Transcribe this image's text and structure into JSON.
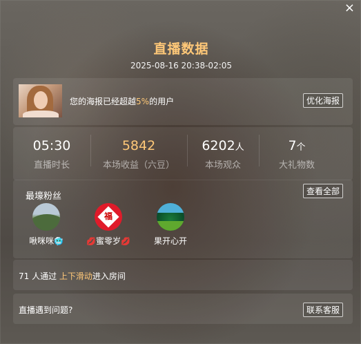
{
  "close_label": "×",
  "title": "直播数据",
  "time_range": "2025-08-16 20:38-02:05",
  "poster": {
    "text_before": "您的海报已经超越",
    "percent": "5%",
    "text_after": "的用户",
    "button": "优化海报"
  },
  "stats": [
    {
      "value": "05:30",
      "unit": "",
      "label": "直播时长"
    },
    {
      "value": "5842",
      "unit": "",
      "label": "本场收益（六豆）"
    },
    {
      "value": "6202",
      "unit": "人",
      "label": "本场观众"
    },
    {
      "value": "7",
      "unit": "个",
      "label": "大礼物数"
    }
  ],
  "fans": {
    "title": "最壕粉丝",
    "view_all": "查看全部",
    "items": [
      {
        "name": "啾咪咪",
        "suffix": "🥶",
        "prefix": ""
      },
      {
        "name": "蜜零岁",
        "suffix": "💋",
        "prefix": "💋"
      },
      {
        "name": "果开心开",
        "suffix": "",
        "prefix": ""
      }
    ],
    "avatar_glyph": "福"
  },
  "tip": {
    "count_text": "71 人通过 ",
    "highlight": "上下滑动",
    "rest": "进入房间"
  },
  "help": {
    "text": "直播遇到问题?",
    "button": "联系客服"
  },
  "colors": {
    "accent": "#ffc878"
  }
}
